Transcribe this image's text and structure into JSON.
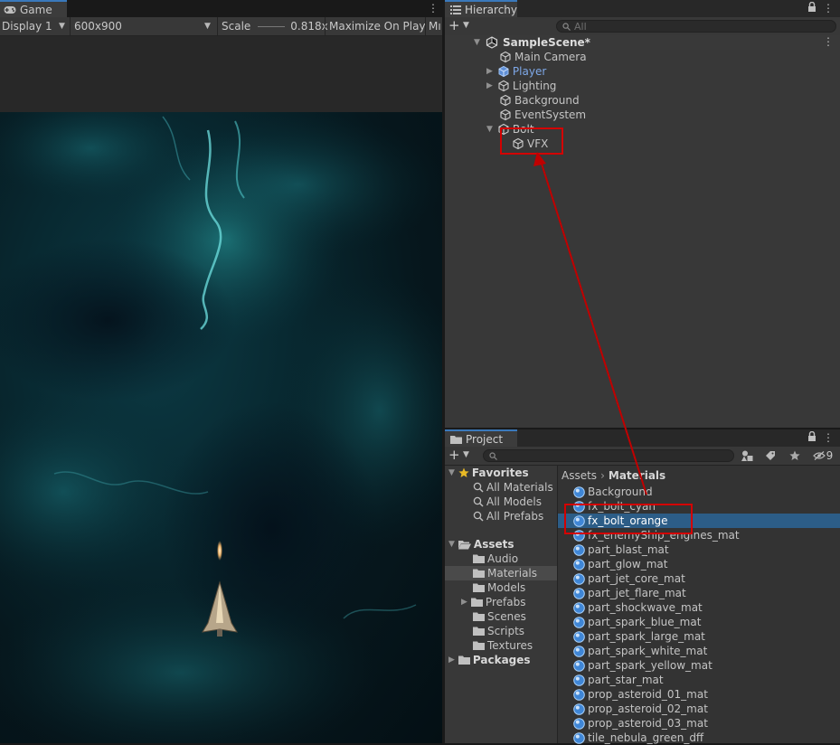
{
  "game": {
    "tab_label": "Game",
    "display_label": "Display 1",
    "resolution_label": "600x900",
    "scale_label": "Scale",
    "scale_value": "0.818x",
    "maximize_label": "Maximize On Play",
    "overflow_label": "Mı"
  },
  "hierarchy": {
    "tab_label": "Hierarchy",
    "search_placeholder": "All",
    "scene_name": "SampleScene*",
    "items": [
      {
        "label": "Main Camera"
      },
      {
        "label": "Player"
      },
      {
        "label": "Lighting"
      },
      {
        "label": "Background"
      },
      {
        "label": "EventSystem"
      },
      {
        "label": "Bolt"
      },
      {
        "label": "VFX"
      }
    ]
  },
  "project": {
    "tab_label": "Project",
    "hidden_count": "9",
    "favorites": {
      "label": "Favorites",
      "items": [
        "All Materials",
        "All Models",
        "All Prefabs"
      ]
    },
    "assets": {
      "label": "Assets",
      "folders": [
        "Audio",
        "Materials",
        "Models",
        "Prefabs",
        "Scenes",
        "Scripts",
        "Textures"
      ]
    },
    "packages_label": "Packages",
    "breadcrumb": {
      "root": "Assets",
      "current": "Materials"
    },
    "materials": [
      "Background",
      "fx_bolt_cyan",
      "fx_bolt_orange",
      "fx_enemyShip_engines_mat",
      "part_blast_mat",
      "part_glow_mat",
      "part_jet_core_mat",
      "part_jet_flare_mat",
      "part_shockwave_mat",
      "part_spark_blue_mat",
      "part_spark_large_mat",
      "part_spark_white_mat",
      "part_spark_yellow_mat",
      "part_star_mat",
      "prop_asteroid_01_mat",
      "prop_asteroid_02_mat",
      "prop_asteroid_03_mat",
      "tile_nebula_green_dff"
    ],
    "selected_material": "fx_bolt_orange"
  },
  "colors": {
    "selection": "#2c5d87",
    "prefab_text": "#7ea8e8",
    "annotation": "#d40000",
    "tab_accent": "#3a79bb"
  }
}
